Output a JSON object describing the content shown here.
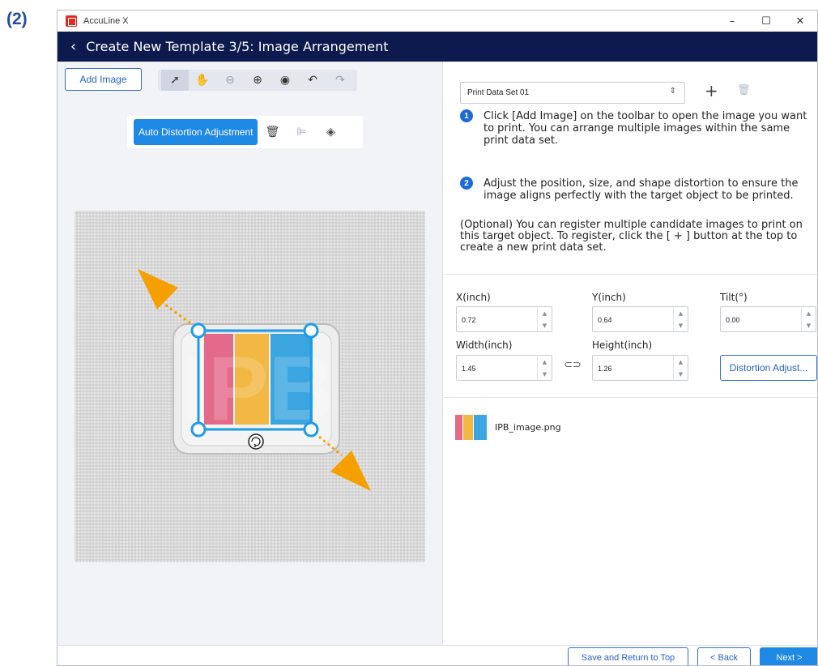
{
  "step_label": "(2)",
  "window": {
    "app_title": "AccuLine X",
    "controls": {
      "minimize": "–",
      "maximize": "☐",
      "close": "✕"
    }
  },
  "header": {
    "back_icon": "chevron-left-icon",
    "title": "Create New Template 3/5: Image Arrangement"
  },
  "toolbar": {
    "add_image_label": "Add Image",
    "tools": [
      {
        "name": "select-arrow-icon",
        "glyph": "➚",
        "active": true,
        "enabled": true
      },
      {
        "name": "hand-pan-icon",
        "glyph": "✋",
        "active": false,
        "enabled": true
      },
      {
        "name": "zoom-out-icon",
        "glyph": "⊖",
        "active": false,
        "enabled": false
      },
      {
        "name": "zoom-in-icon",
        "glyph": "⊕",
        "active": false,
        "enabled": true
      },
      {
        "name": "eye-icon",
        "glyph": "◉",
        "active": false,
        "enabled": true
      },
      {
        "name": "undo-icon",
        "glyph": "↶",
        "active": false,
        "enabled": true
      },
      {
        "name": "redo-icon",
        "glyph": "↷",
        "active": false,
        "enabled": false
      }
    ]
  },
  "floating_toolbar": {
    "auto_distortion_label": "Auto Distortion Adjustment",
    "icons": [
      {
        "name": "trash-icon",
        "glyph": "🗑",
        "enabled": true
      },
      {
        "name": "align-left-icon",
        "glyph": "⊫",
        "enabled": false
      },
      {
        "name": "layers-icon",
        "glyph": "◈",
        "enabled": true
      }
    ]
  },
  "canvas": {
    "placed_image_text": "IPB",
    "accent_color": "#f5a000",
    "handle_color": "#1e9be8",
    "letter_colors": [
      "#e46a8a",
      "#f2b843",
      "#3aa5e0"
    ]
  },
  "panel": {
    "dataset_value": "Print Data Set 01",
    "add_icon": "plus-icon",
    "delete_icon": "trash-icon",
    "steps": [
      {
        "number": "1",
        "text": "Click [Add Image] on the toolbar to open the image you want to print. You can arrange multiple images within the same print data set."
      },
      {
        "number": "2",
        "text": "Adjust the position, size, and shape distortion to ensure the image aligns perfectly with the target object to be printed."
      }
    ],
    "optional_text": "(Optional) You can register multiple candidate images to print on this target object. To register, click the [ + ] button at the top to create a new print data set.",
    "fields": {
      "x_label": "X(inch)",
      "x_value": "0.72",
      "y_label": "Y(inch)",
      "y_value": "0.64",
      "tilt_label": "Tilt(°)",
      "tilt_value": "0.00",
      "width_label": "Width(inch)",
      "width_value": "1.45",
      "height_label": "Height(inch)",
      "height_value": "1.26"
    },
    "distortion_button_label": "Distortion Adjust...",
    "file_name": "IPB_image.png"
  },
  "footer": {
    "save_label": "Save and Return to Top",
    "back_label": "< Back",
    "next_label": "Next >"
  }
}
